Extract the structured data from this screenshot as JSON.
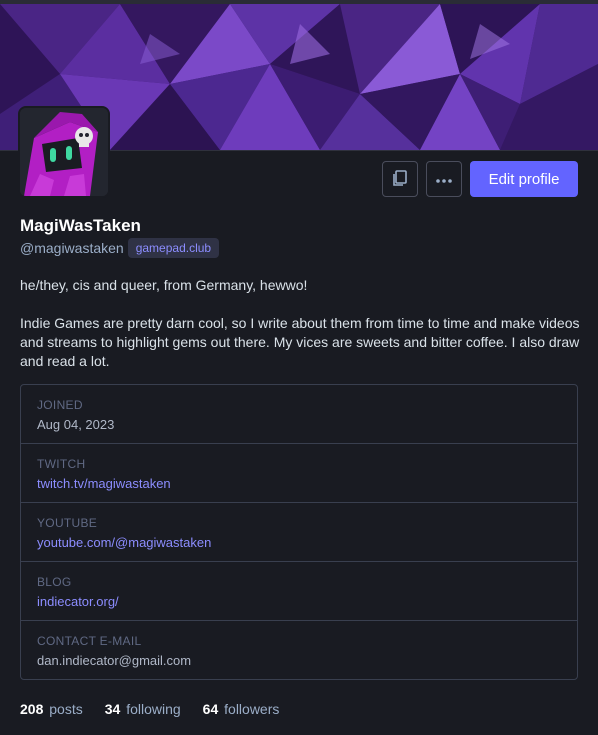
{
  "profile": {
    "display_name": "MagiWasTaken",
    "handle": "@magiwastaken",
    "domain": "gamepad.club",
    "bio": [
      "he/they, cis and queer, from Germany, hewwo!",
      "Indie Games are pretty darn cool, so I write about them from time to time and make videos and streams to highlight gems out there. My vices are sweets and bitter coffee. I also draw and read a lot."
    ]
  },
  "actions": {
    "copy_icon": "copy-icon",
    "more_icon": "ellipsis-icon",
    "edit_label": "Edit profile"
  },
  "fields": [
    {
      "label": "JOINED",
      "value": "Aug 04, 2023",
      "link": false
    },
    {
      "label": "TWITCH",
      "value": "twitch.tv/magiwastaken",
      "link": true
    },
    {
      "label": "YOUTUBE",
      "value": "youtube.com/@magiwastaken",
      "link": true
    },
    {
      "label": "BLOG",
      "value": "indiecator.org/",
      "link": true
    },
    {
      "label": "CONTACT E-MAIL",
      "value": "dan.indiecator@gmail.com",
      "link": false
    }
  ],
  "stats": {
    "posts_count": "208",
    "posts_label": "posts",
    "following_count": "34",
    "following_label": "following",
    "followers_count": "64",
    "followers_label": "followers"
  },
  "colors": {
    "accent": "#6364ff",
    "link": "#8c8dff",
    "background": "#191b22",
    "banner": "#3b1d6e"
  }
}
